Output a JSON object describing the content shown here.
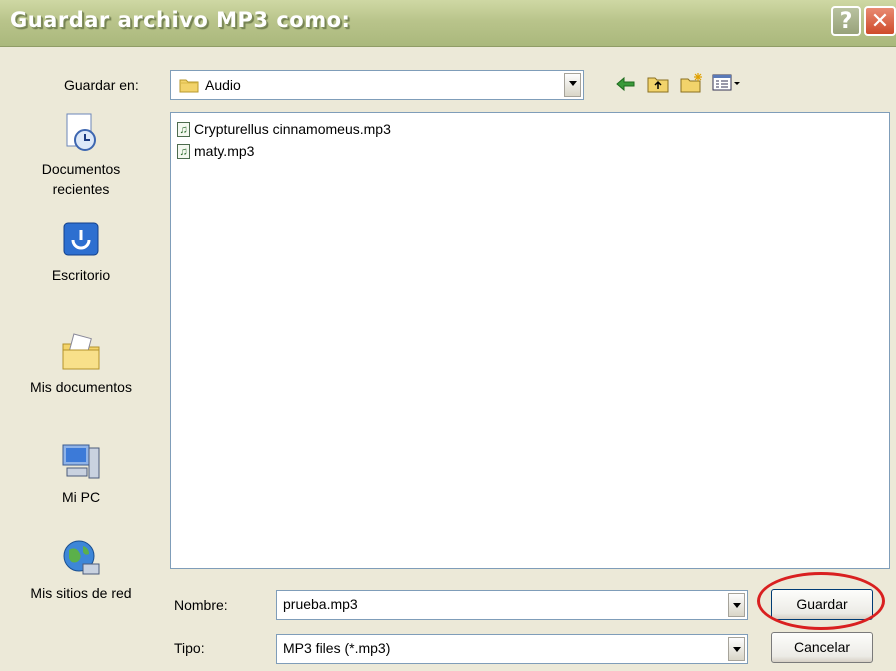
{
  "window": {
    "title": "Guardar archivo MP3 como:"
  },
  "titlebar": {
    "help_label": "?",
    "close_label": "✕"
  },
  "location": {
    "label": "Guardar en:",
    "value": "Audio"
  },
  "sidebar": {
    "items": [
      {
        "label": "Documentos recientes",
        "icon": "recent-documents-icon"
      },
      {
        "label": "Escritorio",
        "icon": "desktop-icon"
      },
      {
        "label": "Mis documentos",
        "icon": "my-documents-icon"
      },
      {
        "label": "Mi PC",
        "icon": "my-computer-icon"
      },
      {
        "label": "Mis sitios de red",
        "icon": "network-places-icon"
      }
    ]
  },
  "files": [
    {
      "name": "Crypturellus cinnamomeus.mp3"
    },
    {
      "name": "maty.mp3"
    }
  ],
  "filename": {
    "label": "Nombre:",
    "value": "prueba.mp3"
  },
  "filetype": {
    "label": "Tipo:",
    "value": "MP3 files (*.mp3)"
  },
  "buttons": {
    "save": "Guardar",
    "cancel": "Cancelar"
  },
  "colors": {
    "highlight_circle": "#d92020",
    "titlebar": "#b9c48b"
  }
}
